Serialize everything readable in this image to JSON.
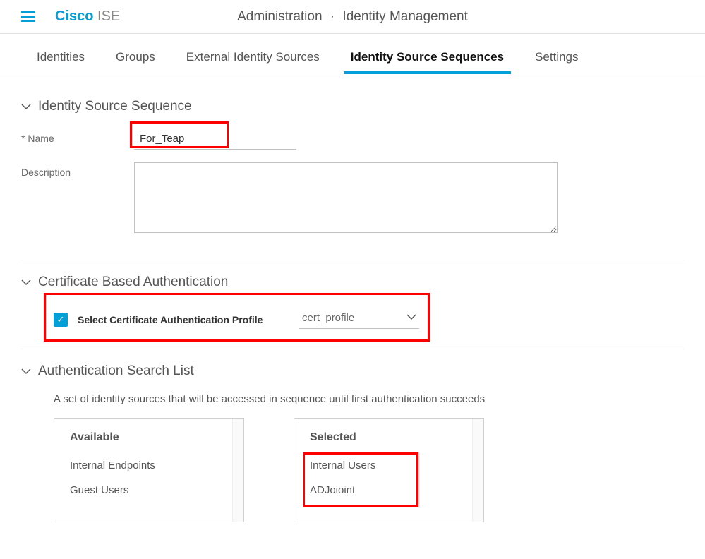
{
  "header": {
    "logo_primary": "Cisco",
    "logo_secondary": "ISE",
    "breadcrumb_left": "Administration",
    "breadcrumb_right": "Identity Management"
  },
  "tabs": {
    "items": [
      {
        "label": "Identities"
      },
      {
        "label": "Groups"
      },
      {
        "label": "External Identity Sources"
      },
      {
        "label": "Identity Source Sequences"
      },
      {
        "label": "Settings"
      }
    ]
  },
  "sections": {
    "iss": {
      "title": "Identity Source Sequence",
      "name_label": "* Name",
      "name_value": "For_Teap",
      "description_label": "Description"
    },
    "cert": {
      "title": "Certificate Based Authentication",
      "check_label": "Select Certificate Authentication Profile",
      "selected_value": "cert_profile"
    },
    "auth": {
      "title": "Authentication Search List",
      "description": "A set of identity sources that will be accessed in sequence until first authentication succeeds",
      "available_head": "Available",
      "selected_head": "Selected",
      "available": [
        {
          "label": "Internal Endpoints"
        },
        {
          "label": "Guest Users"
        }
      ],
      "selected": [
        {
          "label": "Internal Users"
        },
        {
          "label": "ADJoioint"
        }
      ]
    }
  }
}
